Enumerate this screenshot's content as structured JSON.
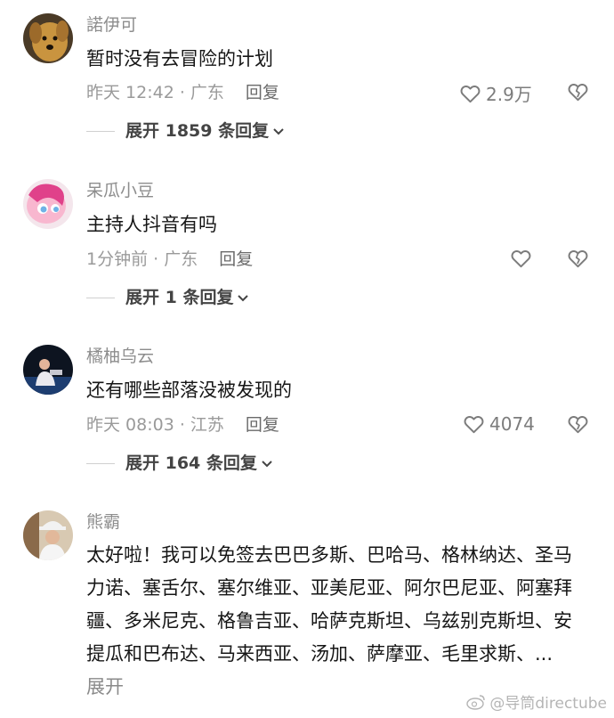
{
  "comments": [
    {
      "username": "諾伊可",
      "text": "暂时没有去冒险的计划",
      "time_location": "昨天 12:42 · 广东",
      "reply_label": "回复",
      "likes": "2.9万",
      "expand_label": "展开 1859 条回复",
      "avatar": "dog-photo"
    },
    {
      "username": "呆瓜小豆",
      "text": "主持人抖音有吗",
      "time_location": "1分钟前 · 广东",
      "reply_label": "回复",
      "likes": "",
      "expand_label": "展开 1 条回复",
      "avatar": "pink-pony-cartoon"
    },
    {
      "username": "橘柚乌云",
      "text": "还有哪些部落没被发现的",
      "time_location": "昨天 08:03 · 江苏",
      "reply_label": "回复",
      "likes": "4074",
      "expand_label": "展开 164 条回复",
      "avatar": "stage-performer-photo"
    },
    {
      "username": "熊霸",
      "text": "太好啦！我可以免签去巴巴多斯、巴哈马、格林纳达、圣马力诺、塞舌尔、塞尔维亚、亚美尼亚、阿尔巴尼亚、阿塞拜疆、多米尼克、格鲁吉亚、哈萨克斯坦、乌兹别克斯坦、安提瓜和巴布达、马来西亚、汤加、萨摩亚、毛里求斯、...",
      "more_label": "展开",
      "avatar": "man-in-hat-photo"
    }
  ],
  "watermark": "@导筒directube",
  "colors": {
    "text": "#161616",
    "meta": "#9a9a9a",
    "icon": "#7c7c7c"
  }
}
